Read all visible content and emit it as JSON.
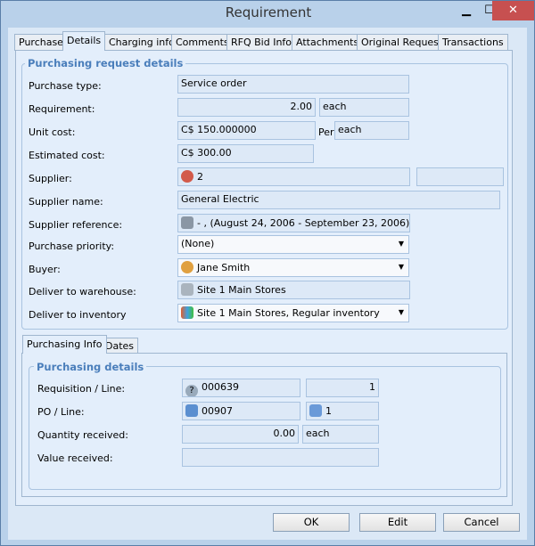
{
  "window": {
    "title": "Requirement",
    "minimize": "▁",
    "maximize": "☐",
    "close": "✕"
  },
  "tabs": [
    "Purchase",
    "Details",
    "Charging info",
    "Comments",
    "RFQ Bid Info",
    "Attachments",
    "Original Request",
    "Transactions"
  ],
  "group1": {
    "title": "Purchasing request details",
    "purchase_type": {
      "label": "Purchase type:",
      "value": "Service order"
    },
    "requirement": {
      "label": "Requirement:",
      "value": "2.00",
      "unit": "each"
    },
    "unit_cost": {
      "label": "Unit cost:",
      "value": "C$ 150.000000",
      "per": "Per",
      "unit": "each"
    },
    "estimated_cost": {
      "label": "Estimated cost:",
      "value": "C$ 300.00"
    },
    "supplier": {
      "label": "Supplier:",
      "value": "2",
      "extra": ""
    },
    "supplier_name": {
      "label": "Supplier name:",
      "value": "General Electric"
    },
    "supplier_reference": {
      "label": "Supplier reference:",
      "value": "- , (August 24, 2006 - September 23, 2006)"
    },
    "purchase_priority": {
      "label": "Purchase priority:",
      "value": "(None)"
    },
    "buyer": {
      "label": "Buyer:",
      "value": "Jane Smith"
    },
    "deliver_warehouse": {
      "label": "Deliver to warehouse:",
      "value": "Site 1 Main Stores"
    },
    "deliver_inventory": {
      "label": "Deliver to inventory",
      "value": "Site 1 Main Stores, Regular inventory"
    }
  },
  "subtabs": [
    "Purchasing Info",
    "Dates"
  ],
  "group2": {
    "title": "Purchasing details",
    "requisition": {
      "label": "Requisition / Line:",
      "value": "000639",
      "line": "1"
    },
    "po": {
      "label": "PO / Line:",
      "value": "00907",
      "line": "1"
    },
    "qty_received": {
      "label": "Quantity received:",
      "value": "0.00",
      "unit": "each"
    },
    "value_received": {
      "label": "Value received:",
      "value": ""
    }
  },
  "buttons": {
    "ok": "OK",
    "edit": "Edit",
    "cancel": "Cancel"
  }
}
